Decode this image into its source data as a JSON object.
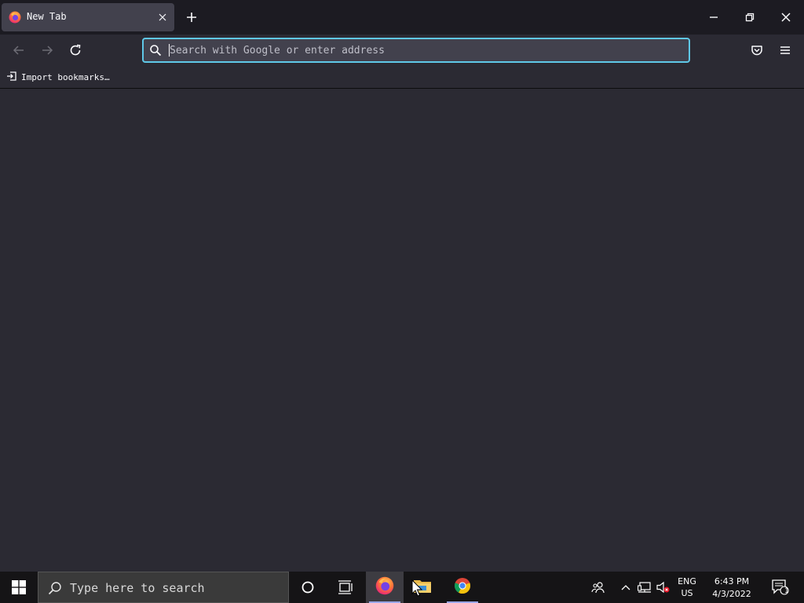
{
  "tab": {
    "title": "New Tab",
    "favicon": "firefox-icon",
    "close_icon": "close-icon"
  },
  "new_tab_icon": "plus-icon",
  "window_controls": {
    "minimize_icon": "minimize-icon",
    "maximize_icon": "restore-icon",
    "close_icon": "close-icon"
  },
  "nav": {
    "back_icon": "back-arrow-icon",
    "forward_icon": "forward-arrow-icon",
    "reload_icon": "reload-icon",
    "pocket_icon": "pocket-icon",
    "menu_icon": "hamburger-menu-icon"
  },
  "urlbar": {
    "placeholder": "Search with Google or enter address",
    "value": ""
  },
  "bookmarks": {
    "items": [
      {
        "label": "Import bookmarks…",
        "icon": "import-icon"
      }
    ]
  },
  "taskbar": {
    "search_placeholder": "Type here to search",
    "apps": [
      "firefox",
      "file-explorer",
      "chrome"
    ],
    "tray": {
      "language_top": "ENG",
      "language_bottom": "US",
      "time": "6:43 PM",
      "date": "4/3/2022",
      "notification_count": "1"
    }
  },
  "colors": {
    "accent": "#5fc8e8",
    "toolbar": "#2b2a33",
    "tabstrip": "#1c1b22",
    "selected_tab": "#42414d"
  }
}
